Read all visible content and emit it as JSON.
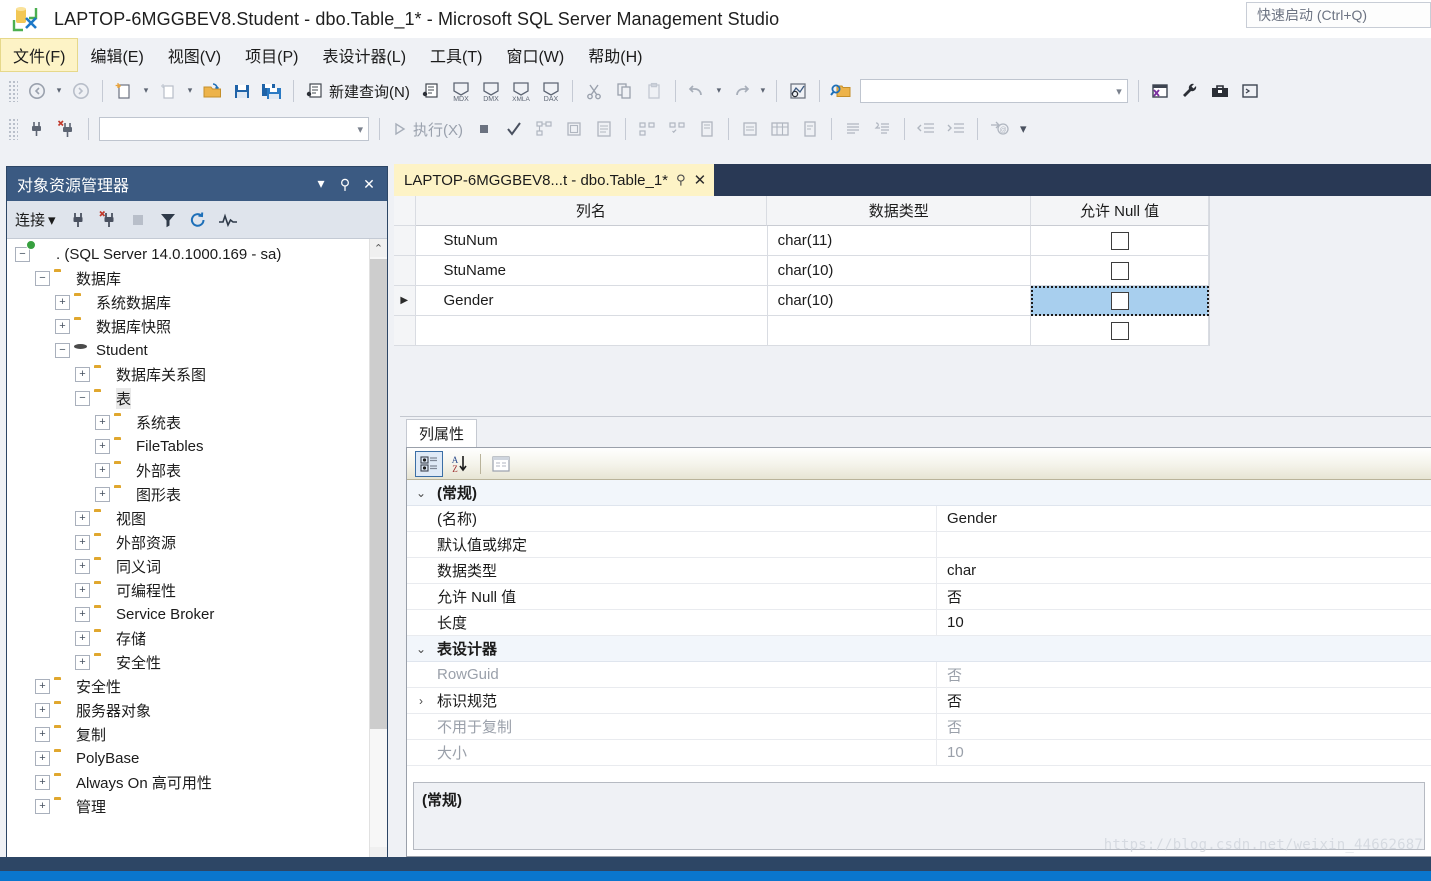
{
  "window": {
    "title": "LAPTOP-6MGGBEV8.Student - dbo.Table_1* - Microsoft SQL Server Management Studio",
    "quick_launch": "快速启动 (Ctrl+Q)",
    "logo_icon": "ssms-logo-icon"
  },
  "menubar": {
    "items": [
      {
        "label": "文件(F)",
        "active": true
      },
      {
        "label": "编辑(E)",
        "active": false
      },
      {
        "label": "视图(V)",
        "active": false
      },
      {
        "label": "项目(P)",
        "active": false
      },
      {
        "label": "表设计器(L)",
        "active": false
      },
      {
        "label": "工具(T)",
        "active": false
      },
      {
        "label": "窗口(W)",
        "active": false
      },
      {
        "label": "帮助(H)",
        "active": false
      }
    ]
  },
  "toolbar_row1": {
    "new_query_label": "新建查询(N)",
    "mdx_label": "MDX",
    "dmx_label": "DMX",
    "xmla_label": "XMLA",
    "dax_label": "DAX",
    "search_value": "",
    "icons": [
      "navigate-back-icon",
      "navigate-forward-icon",
      "new-project-icon",
      "new-item-icon",
      "open-folder-icon",
      "save-icon",
      "save-all-icon",
      "new-query-icon",
      "new-analysis-query-icon",
      "cut-icon",
      "copy-icon",
      "paste-icon",
      "undo-icon",
      "redo-icon",
      "show-diagram-pane-icon",
      "find-in-files-icon",
      "toggle-window-icon",
      "tools-wrench-icon",
      "toolbox-icon",
      "command-window-icon"
    ]
  },
  "toolbar_row2": {
    "execute_label": "执行(X)",
    "database_combo_value": "",
    "icons": [
      "connect-icon",
      "disconnect-icon",
      "execute-icon",
      "stop-icon",
      "parse-check-icon",
      "display-estimated-plan-icon",
      "query-options-icon",
      "include-actual-plan-icon",
      "results-to-text-icon",
      "results-to-grid-icon",
      "results-to-file-icon",
      "comment-icon",
      "uncomment-icon",
      "decrease-indent-icon",
      "increase-indent-icon",
      "specify-values-icon",
      "toolbar-overflow-icon"
    ]
  },
  "object_explorer": {
    "title": "对象资源管理器",
    "header_buttons": [
      "chevron-down-icon",
      "pin-icon",
      "close-icon"
    ],
    "toolbar": {
      "connect_label": "连接",
      "icons": [
        "connect-plug-icon",
        "disconnect-plug-icon",
        "stop-icon",
        "filter-icon",
        "refresh-icon",
        "activity-monitor-icon"
      ]
    },
    "tree": [
      {
        "label": ". (SQL Server 14.0.1000.169 - sa)",
        "indent": 0,
        "state": "minus",
        "icon": "server-icon",
        "selected": false
      },
      {
        "label": "数据库",
        "indent": 1,
        "state": "minus",
        "icon": "folder-icon",
        "selected": false
      },
      {
        "label": "系统数据库",
        "indent": 2,
        "state": "plus",
        "icon": "folder-icon",
        "selected": false
      },
      {
        "label": "数据库快照",
        "indent": 2,
        "state": "plus",
        "icon": "folder-icon",
        "selected": false
      },
      {
        "label": "Student",
        "indent": 2,
        "state": "minus",
        "icon": "database-icon",
        "selected": false
      },
      {
        "label": "数据库关系图",
        "indent": 3,
        "state": "plus",
        "icon": "folder-icon",
        "selected": false
      },
      {
        "label": "表",
        "indent": 3,
        "state": "minus",
        "icon": "folder-icon",
        "selected": true
      },
      {
        "label": "系统表",
        "indent": 4,
        "state": "plus",
        "icon": "folder-icon",
        "selected": false
      },
      {
        "label": "FileTables",
        "indent": 4,
        "state": "plus",
        "icon": "folder-icon",
        "selected": false
      },
      {
        "label": "外部表",
        "indent": 4,
        "state": "plus",
        "icon": "folder-icon",
        "selected": false
      },
      {
        "label": "图形表",
        "indent": 4,
        "state": "plus",
        "icon": "folder-icon",
        "selected": false
      },
      {
        "label": "视图",
        "indent": 3,
        "state": "plus",
        "icon": "folder-icon",
        "selected": false
      },
      {
        "label": "外部资源",
        "indent": 3,
        "state": "plus",
        "icon": "folder-icon",
        "selected": false
      },
      {
        "label": "同义词",
        "indent": 3,
        "state": "plus",
        "icon": "folder-icon",
        "selected": false
      },
      {
        "label": "可编程性",
        "indent": 3,
        "state": "plus",
        "icon": "folder-icon",
        "selected": false
      },
      {
        "label": "Service Broker",
        "indent": 3,
        "state": "plus",
        "icon": "folder-icon",
        "selected": false
      },
      {
        "label": "存储",
        "indent": 3,
        "state": "plus",
        "icon": "folder-icon",
        "selected": false
      },
      {
        "label": "安全性",
        "indent": 3,
        "state": "plus",
        "icon": "folder-icon",
        "selected": false
      },
      {
        "label": "安全性",
        "indent": 1,
        "state": "plus",
        "icon": "folder-icon",
        "selected": false
      },
      {
        "label": "服务器对象",
        "indent": 1,
        "state": "plus",
        "icon": "folder-icon",
        "selected": false
      },
      {
        "label": "复制",
        "indent": 1,
        "state": "plus",
        "icon": "folder-icon",
        "selected": false
      },
      {
        "label": "PolyBase",
        "indent": 1,
        "state": "plus",
        "icon": "folder-icon",
        "selected": false
      },
      {
        "label": "Always On 高可用性",
        "indent": 1,
        "state": "plus",
        "icon": "folder-icon",
        "selected": false
      },
      {
        "label": "管理",
        "indent": 1,
        "state": "plus",
        "icon": "folder-icon",
        "selected": false
      }
    ]
  },
  "document_tab": {
    "label": "LAPTOP-6MGGBEV8...t - dbo.Table_1*",
    "pin_icon": "pin-icon",
    "close_icon": "close-icon"
  },
  "table_designer": {
    "columns": [
      "列名",
      "数据类型",
      "允许 Null 值"
    ],
    "rows": [
      {
        "name": "StuNum",
        "type": "char(11)",
        "allow_null": false,
        "current": false,
        "selected_cell": false
      },
      {
        "name": "StuName",
        "type": "char(10)",
        "allow_null": false,
        "current": false,
        "selected_cell": false
      },
      {
        "name": "Gender",
        "type": "char(10)",
        "allow_null": false,
        "current": true,
        "selected_cell": true
      },
      {
        "name": "",
        "type": "",
        "allow_null": false,
        "current": false,
        "selected_cell": false
      }
    ]
  },
  "column_properties": {
    "tab_label": "列属性",
    "toolbar_icons": [
      "categorized-view-icon",
      "alphabetical-sort-icon",
      "property-pages-icon"
    ],
    "rows": [
      {
        "kind": "category",
        "name": "(常规)",
        "value": "",
        "expander": "chevron-down-icon",
        "dim": false
      },
      {
        "kind": "property",
        "name": "(名称)",
        "value": "Gender",
        "expander": "",
        "dim": false
      },
      {
        "kind": "property",
        "name": "默认值或绑定",
        "value": "",
        "expander": "",
        "dim": false
      },
      {
        "kind": "property",
        "name": "数据类型",
        "value": "char",
        "expander": "",
        "dim": false
      },
      {
        "kind": "property",
        "name": "允许 Null 值",
        "value": "否",
        "expander": "",
        "dim": false
      },
      {
        "kind": "property",
        "name": "长度",
        "value": "10",
        "expander": "",
        "dim": false
      },
      {
        "kind": "category",
        "name": "表设计器",
        "value": "",
        "expander": "chevron-down-icon",
        "dim": false
      },
      {
        "kind": "property",
        "name": "RowGuid",
        "value": "否",
        "expander": "",
        "dim": true
      },
      {
        "kind": "property",
        "name": "标识规范",
        "value": "否",
        "expander": "chevron-right-icon",
        "dim": false
      },
      {
        "kind": "property",
        "name": "不用于复制",
        "value": "否",
        "expander": "",
        "dim": true
      },
      {
        "kind": "property",
        "name": "大小",
        "value": "10",
        "expander": "",
        "dim": true
      }
    ],
    "description_title": "(常规)"
  },
  "watermark": "https://blog.csdn.net/weixin_44662687",
  "colors": {
    "accent_blue": "#0a76cd",
    "status_bar": "#2d4665",
    "oe_header": "#3b5a82",
    "tab_active": "#fdf3c6",
    "cell_selected": "#a8cfee",
    "folder": "#e0a72e"
  }
}
